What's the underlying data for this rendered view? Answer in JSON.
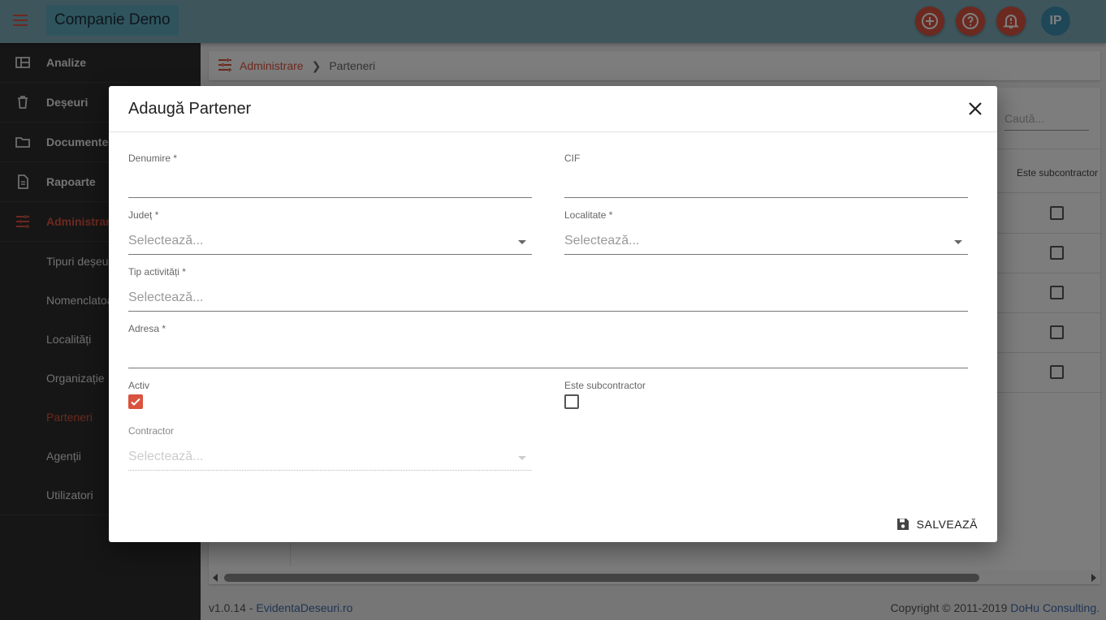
{
  "topbar": {
    "company": "Companie Demo",
    "avatar_initials": "IP",
    "accent": "#d9533e"
  },
  "sidebar": {
    "items": [
      {
        "label": "Analize",
        "icon": "dashboard-icon"
      },
      {
        "label": "Deșeuri",
        "icon": "trash-icon"
      },
      {
        "label": "Documente",
        "icon": "folder-icon"
      },
      {
        "label": "Rapoarte",
        "icon": "file-icon"
      },
      {
        "label": "Administrare",
        "icon": "sliders-icon"
      }
    ],
    "sub_items": [
      {
        "label": "Tipuri deșeuri"
      },
      {
        "label": "Nomenclatoare"
      },
      {
        "label": "Localități"
      },
      {
        "label": "Organizație"
      },
      {
        "label": "Parteneri"
      },
      {
        "label": "Agenții"
      },
      {
        "label": "Utilizatori"
      }
    ]
  },
  "breadcrumb": {
    "parent": "Administrare",
    "current": "Parteneri"
  },
  "background": {
    "search_placeholder": "Caută...",
    "column_header": "Este subcontractor",
    "row_count": 5
  },
  "footer": {
    "version": "v1.0.14",
    "separator": " - ",
    "site": "EvidentaDeseuri.ro",
    "copyright": "Copyright © 2011-2019 ",
    "company": "DoHu Consulting."
  },
  "modal": {
    "title": "Adaugă Partener",
    "fields": {
      "denumire": {
        "label": "Denumire *",
        "value": ""
      },
      "cif": {
        "label": "CIF",
        "value": ""
      },
      "judet": {
        "label": "Județ *",
        "placeholder": "Selectează..."
      },
      "localitate": {
        "label": "Localitate *",
        "placeholder": "Selectează..."
      },
      "tip_activitati": {
        "label": "Tip activități *",
        "placeholder": "Selectează..."
      },
      "adresa": {
        "label": "Adresa *",
        "value": ""
      },
      "activ": {
        "label": "Activ",
        "checked": true
      },
      "subcontractor": {
        "label": "Este subcontractor",
        "checked": false
      },
      "contractor": {
        "label": "Contractor",
        "placeholder": "Selectează...",
        "disabled": true
      }
    },
    "save_label": "SALVEAZĂ"
  }
}
